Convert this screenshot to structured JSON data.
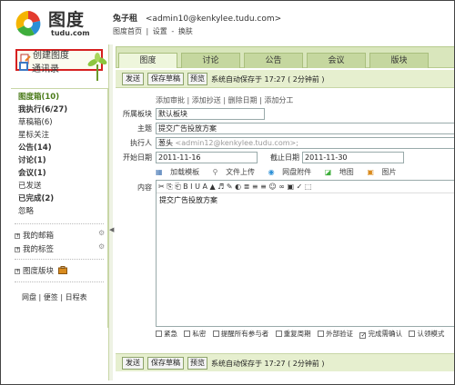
{
  "header": {
    "logo_text": "图度",
    "logo_domain": "tudu.com",
    "user_name": "兔子租",
    "user_email": "<admin10@kenkylee.tudu.com>",
    "links": [
      "图度首页",
      "|",
      "设置",
      "-",
      "换肤"
    ]
  },
  "sidebar": {
    "create_label": "创建图度",
    "contacts_label": "通讯录",
    "folders": [
      {
        "label": "图度箱(10)",
        "style": "bold-green"
      },
      {
        "label": "我执行(6/27)",
        "style": "bold"
      },
      {
        "label": "草稿箱(6)",
        "style": "normal"
      },
      {
        "label": "星标关注",
        "style": "normal"
      },
      {
        "label": "公告(14)",
        "style": "bold"
      },
      {
        "label": "讨论(1)",
        "style": "bold"
      },
      {
        "label": "会议(1)",
        "style": "bold"
      },
      {
        "label": "已发送",
        "style": "normal"
      },
      {
        "label": "已完成(2)",
        "style": "bold"
      },
      {
        "label": "忽略",
        "style": "normal"
      }
    ],
    "tree": [
      "我的邮箱",
      "我的标签",
      "图度版块"
    ],
    "tools": [
      "网盘",
      "|",
      "便签",
      "|",
      "日程表"
    ]
  },
  "tabs": [
    "图度",
    "讨论",
    "公告",
    "会议",
    "版块"
  ],
  "toolbar": {
    "send": "发送",
    "save_draft": "保存草稿",
    "preview": "预览",
    "autosave": "系统自动保存于 17:27 ( 2分钟前 )"
  },
  "form": {
    "add_links": [
      "添加审批",
      "|",
      "添加抄送",
      "|",
      "删除日期",
      "|",
      "添加分工"
    ],
    "board_label": "所属板块",
    "board_value": "默认板块",
    "subject_label": "主题",
    "subject_value": "提交广告投放方案",
    "assignee_label": "执行人",
    "assignee_name": "葱头",
    "assignee_value": "<admin12@kenkylee.tudu.com>;",
    "start_label": "开始日期",
    "start_value": "2011-11-16",
    "end_label": "截止日期",
    "end_value": "2011-11-30",
    "attachments": [
      "加载模板",
      "文件上传",
      "网盘附件",
      "地图",
      "图片"
    ],
    "content_label": "内容",
    "content_text": "提交广告投放方案",
    "editor_toolbar": "✂ ⎘ ⎗ B I U A ▲ ♬ ✎ ◐ ≣ ≡ ≡ ☺ ∞ ▣ ✓ ⬚"
  },
  "options": [
    {
      "label": "紧急",
      "checked": false
    },
    {
      "label": "私密",
      "checked": false
    },
    {
      "label": "提醒所有参与者",
      "checked": false
    },
    {
      "label": "重复周期",
      "checked": false
    },
    {
      "label": "外部验证",
      "checked": false
    },
    {
      "label": "完成需确认",
      "checked": true
    },
    {
      "label": "认领模式",
      "checked": false
    }
  ],
  "colors": {
    "accent_green": "#4a7a19",
    "tab_bar": "#d9e6bc",
    "toolbar_bg": "#e6efcf",
    "highlight_border": "#d62020"
  }
}
